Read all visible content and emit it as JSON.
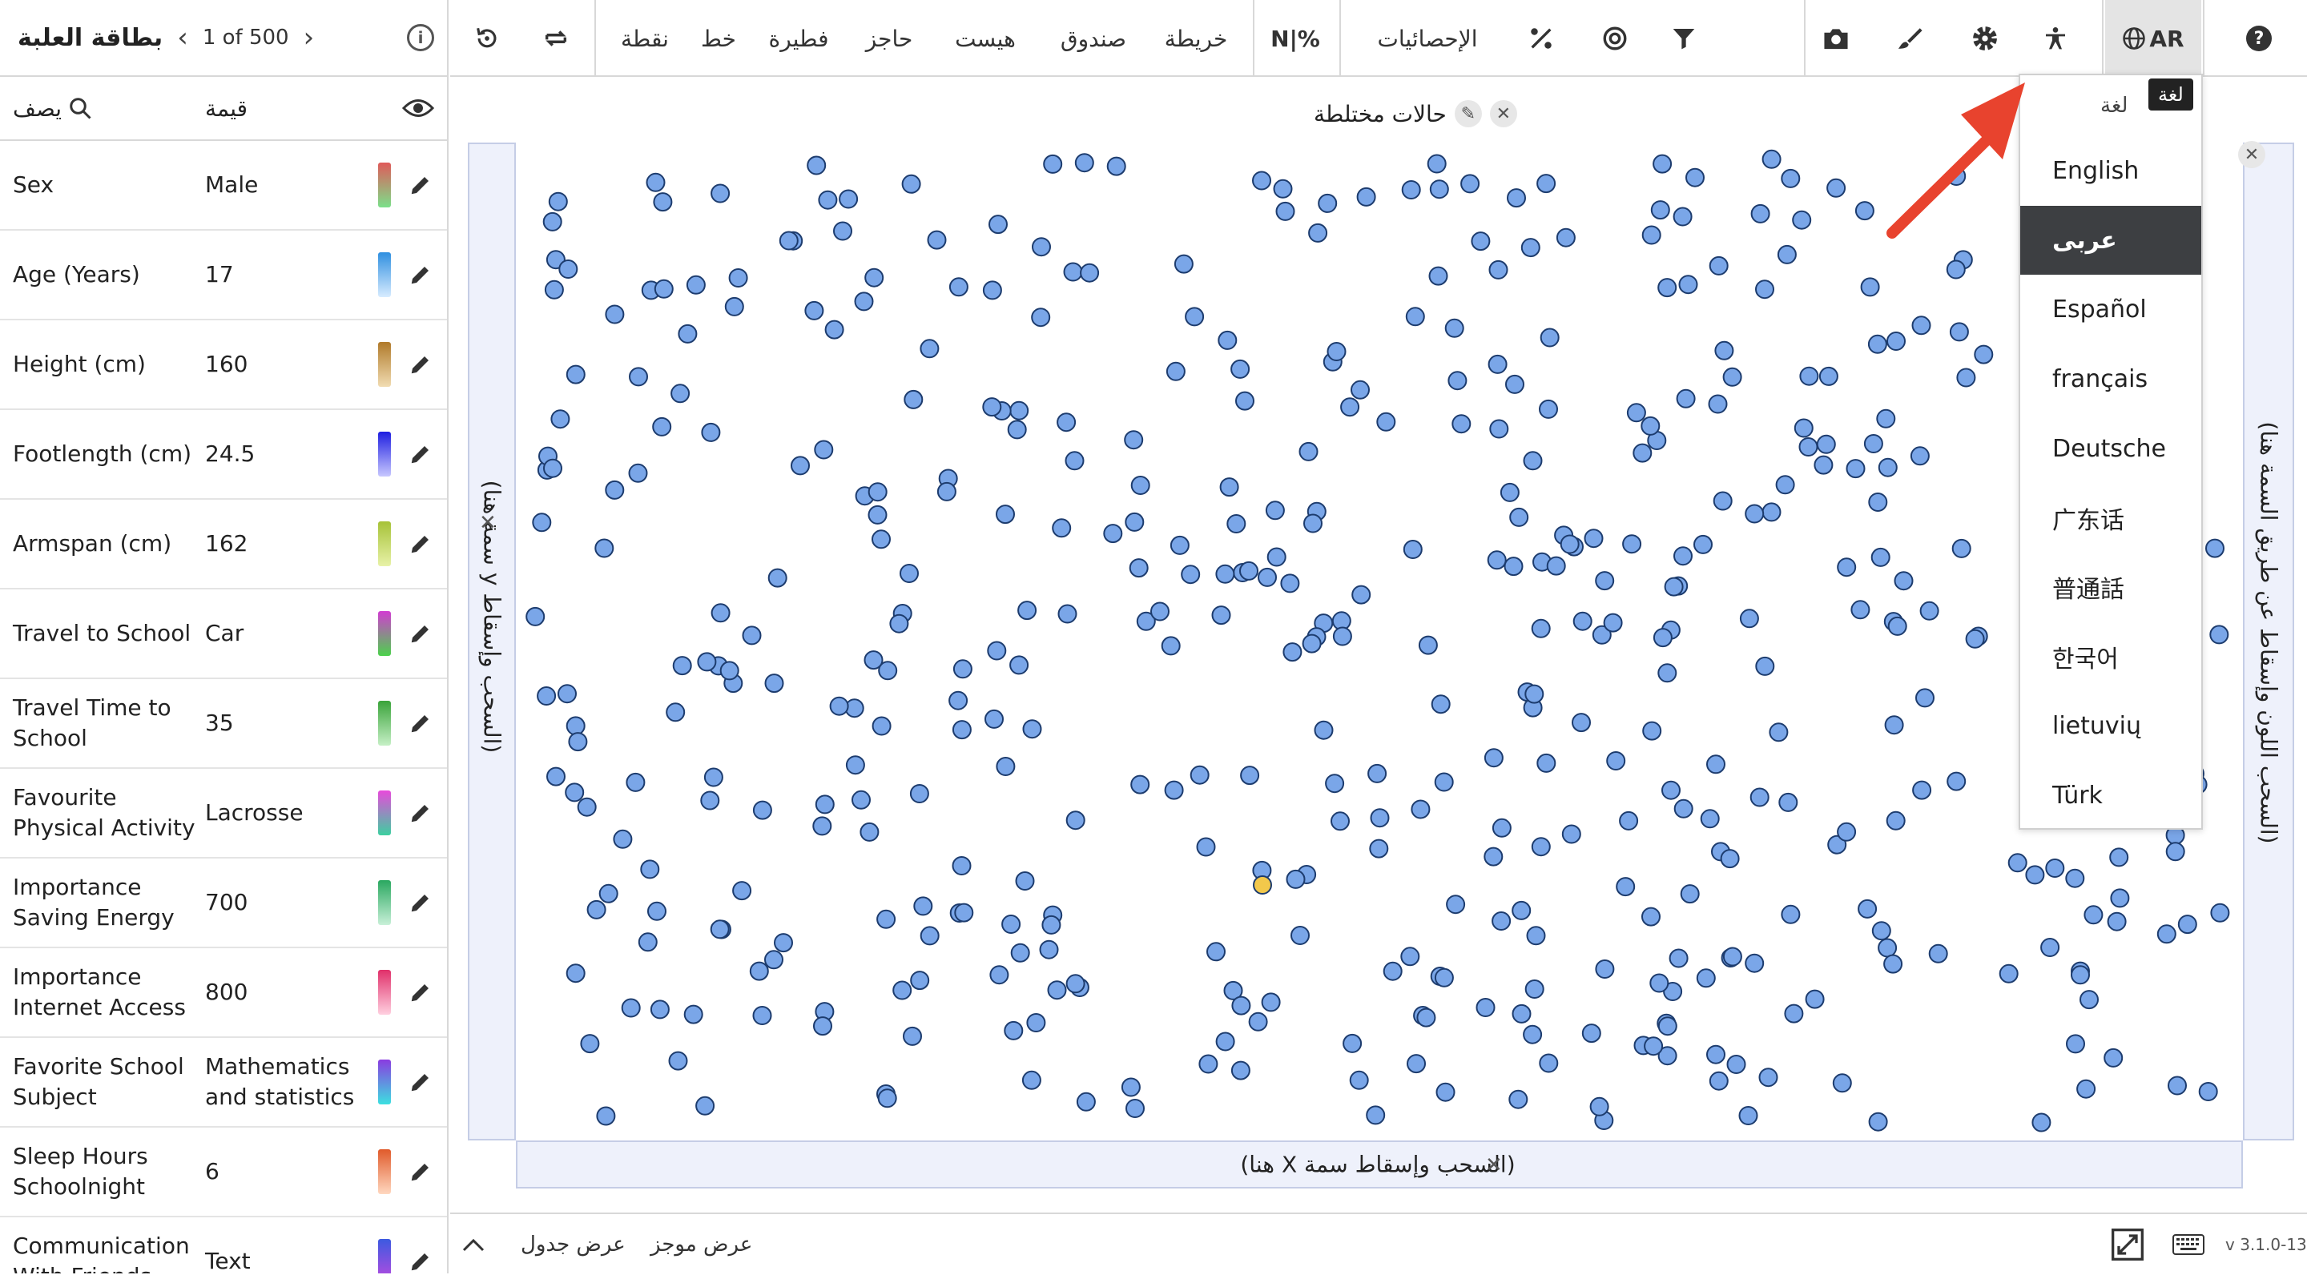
{
  "sidebar": {
    "title": "بطاقة العلبة",
    "counter": "1 of 500",
    "info_icon": "info-icon",
    "col_describe": "يصف",
    "col_value": "قيمة",
    "rows": [
      {
        "k": "Sex",
        "v": "Male",
        "c1": "#e05a5a",
        "c2": "#7be08a"
      },
      {
        "k": "Age (Years)",
        "v": "17",
        "c1": "#2f8fe0",
        "c2": "#d8ecff"
      },
      {
        "k": "Height (cm)",
        "v": "160",
        "c1": "#b07a2a",
        "c2": "#f1dcb2"
      },
      {
        "k": "Footlength (cm)",
        "v": "24.5",
        "c1": "#1e1ee0",
        "c2": "#c8c8ff"
      },
      {
        "k": "Armspan (cm)",
        "v": "162",
        "c1": "#a6c238",
        "c2": "#e8f2a8"
      },
      {
        "k": "Travel to School",
        "v": "Car",
        "c1": "#d23cd2",
        "c2": "#4bd24b"
      },
      {
        "k": "Travel Time to School",
        "v": "35",
        "c1": "#3aa33a",
        "c2": "#c6f0c6"
      },
      {
        "k": "Favourite Physical Activity",
        "v": "Lacrosse",
        "c1": "#e84adb",
        "c2": "#3cd0a0"
      },
      {
        "k": "Importance Saving Energy",
        "v": "700",
        "c1": "#2aa860",
        "c2": "#c8f0d8"
      },
      {
        "k": "Importance Internet Access",
        "v": "800",
        "c1": "#e0306a",
        "c2": "#ffd0e0"
      },
      {
        "k": "Favorite School Subject",
        "v": "Mathematics and statistics",
        "c1": "#8a3ce0",
        "c2": "#3ce0e0"
      },
      {
        "k": "Sleep Hours Schoolnight",
        "v": "6",
        "c1": "#e05a2a",
        "c2": "#ffd8c0"
      },
      {
        "k": "Communication With Friends",
        "v": "Text",
        "c1": "#3c5ae0",
        "c2": "#c04ae0"
      }
    ]
  },
  "toolbar": {
    "tools": [
      "نقطة",
      "خط",
      "فطيرة",
      "حاجز",
      "هيست",
      "صندوق",
      "خريطة",
      "N|%",
      "الإحصائيات"
    ],
    "lang_button": "AR"
  },
  "graph": {
    "title": "حالات مختلطة",
    "x_drop": "(هنا X السحب وإسقاط سمة)",
    "y_drop": "(سمة هنا y السحب وإسقاط)",
    "legend_drop": "(السحب اللون وإسقاط عن طريق السمة هنا)",
    "dot_color": "#7aa6e8",
    "dot_stroke": "#1d3c6e",
    "highlight_color": "#f2c84b"
  },
  "language": {
    "header": "لغة",
    "tooltip": "لغة",
    "items": [
      "English",
      "عربى",
      "Español",
      "français",
      "Deutsche",
      "广东话",
      "普通話",
      "한국어",
      "lietuvių",
      "Türk"
    ],
    "selected": "عربى"
  },
  "bottombar": {
    "table_view": "عرض جدول",
    "summary_view": "عرض موجز",
    "version": "v 3.1.0-13"
  }
}
